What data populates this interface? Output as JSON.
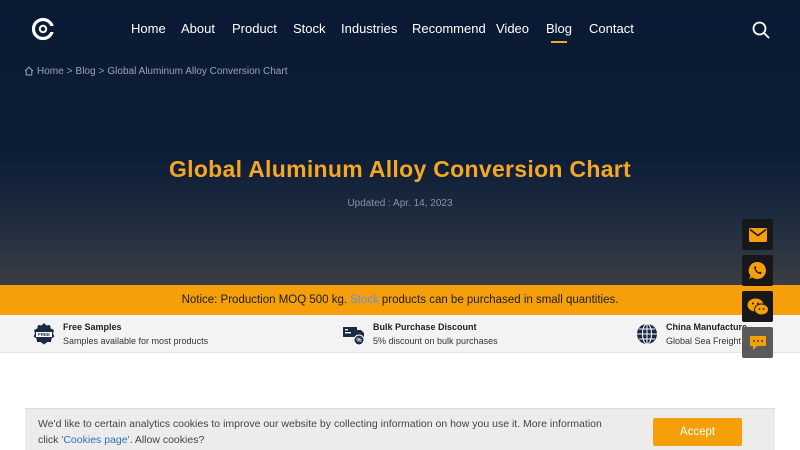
{
  "nav": {
    "items": [
      {
        "label": "Home"
      },
      {
        "label": "About"
      },
      {
        "label": "Product"
      },
      {
        "label": "Stock"
      },
      {
        "label": "Industries"
      },
      {
        "label": "Recommend"
      },
      {
        "label": "Video"
      },
      {
        "label": "Blog",
        "active": true
      },
      {
        "label": "Contact"
      }
    ]
  },
  "breadcrumb": {
    "home": "Home",
    "sep": ">",
    "blog": "Blog",
    "current": "Global Aluminum Alloy Conversion Chart"
  },
  "page": {
    "title": "Global Aluminum Alloy Conversion Chart",
    "updated": "Updated : Apr. 14, 2023"
  },
  "notice": {
    "prefix": "Notice: Production MOQ 500 kg.",
    "link": "Stock",
    "suffix": "products can be purchased in small quantities."
  },
  "features": [
    {
      "icon": "free-badge-icon",
      "title": "Free Samples",
      "subtitle": "Samples available for most products"
    },
    {
      "icon": "discount-truck-icon",
      "title": "Bulk Purchase Discount",
      "subtitle": "5% discount on bulk purchases"
    },
    {
      "icon": "globe-icon",
      "title": "China Manufacture",
      "subtitle": "Global Sea Freight Se"
    }
  ],
  "floating": [
    "email-icon",
    "whatsapp-icon",
    "wechat-icon",
    "message-icon"
  ],
  "cookie": {
    "text": "We'd like to certain analytics cookies to improve our website by collecting information on how you use it. More information click",
    "link": "'Cookies page'",
    "text_end": ". Allow cookies?",
    "accept": "Accept"
  },
  "colors": {
    "accent": "#f5a623",
    "notice_bg": "#f5a00a",
    "hero_bg": "#0a1a33"
  }
}
